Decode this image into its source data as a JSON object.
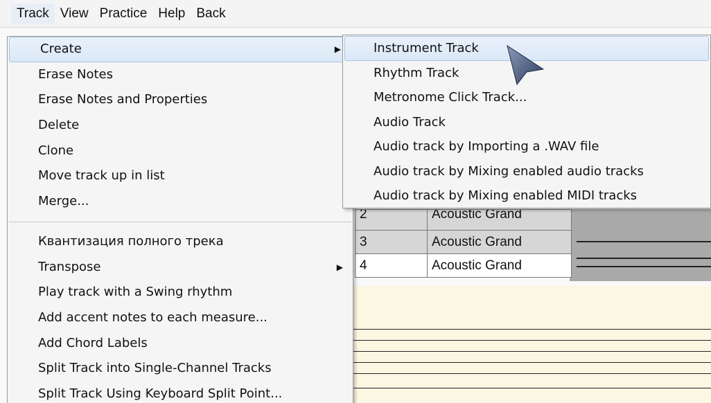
{
  "menubar": {
    "items": [
      "Track",
      "View",
      "Practice",
      "Help",
      "Back"
    ]
  },
  "track_menu": {
    "group1": [
      {
        "label": "Create",
        "has_submenu": true
      },
      {
        "label": "Erase Notes"
      },
      {
        "label": "Erase Notes and Properties"
      },
      {
        "label": "Delete"
      },
      {
        "label": "Clone"
      },
      {
        "label": "Move track up in list"
      },
      {
        "label": "Merge..."
      }
    ],
    "group2": [
      {
        "label": "Квантизация полного трека"
      },
      {
        "label": "Transpose",
        "has_submenu": true
      },
      {
        "label": "Play track with a Swing rhythm"
      },
      {
        "label": "Add accent notes to each measure..."
      },
      {
        "label": "Add Chord Labels"
      },
      {
        "label": "Split Track into Single-Channel Tracks"
      },
      {
        "label": "Split Track Using Keyboard Split Point..."
      }
    ]
  },
  "create_submenu": {
    "items": [
      {
        "label": "Instrument Track"
      },
      {
        "label": "Rhythm Track"
      },
      {
        "label": "Metronome Click Track..."
      },
      {
        "label": "Audio Track"
      },
      {
        "label": "Audio track by Importing a .WAV file"
      },
      {
        "label": "Audio track by Mixing enabled audio tracks"
      },
      {
        "label": "Audio track by Mixing enabled MIDI tracks"
      }
    ]
  },
  "track_list": {
    "rows": [
      {
        "num": "2",
        "instrument": "Acoustic Grand"
      },
      {
        "num": "3",
        "instrument": "Acoustic Grand"
      },
      {
        "num": "4",
        "instrument": "Acoustic Grand"
      }
    ]
  },
  "icons": {
    "submenu_arrow": "submenu-arrow-icon",
    "cursor": "mouse-cursor-icon"
  },
  "colors": {
    "highlight": "#dbe8f7",
    "staff_bg": "#fbf7e3",
    "row_gray": "#d6d6d6"
  }
}
